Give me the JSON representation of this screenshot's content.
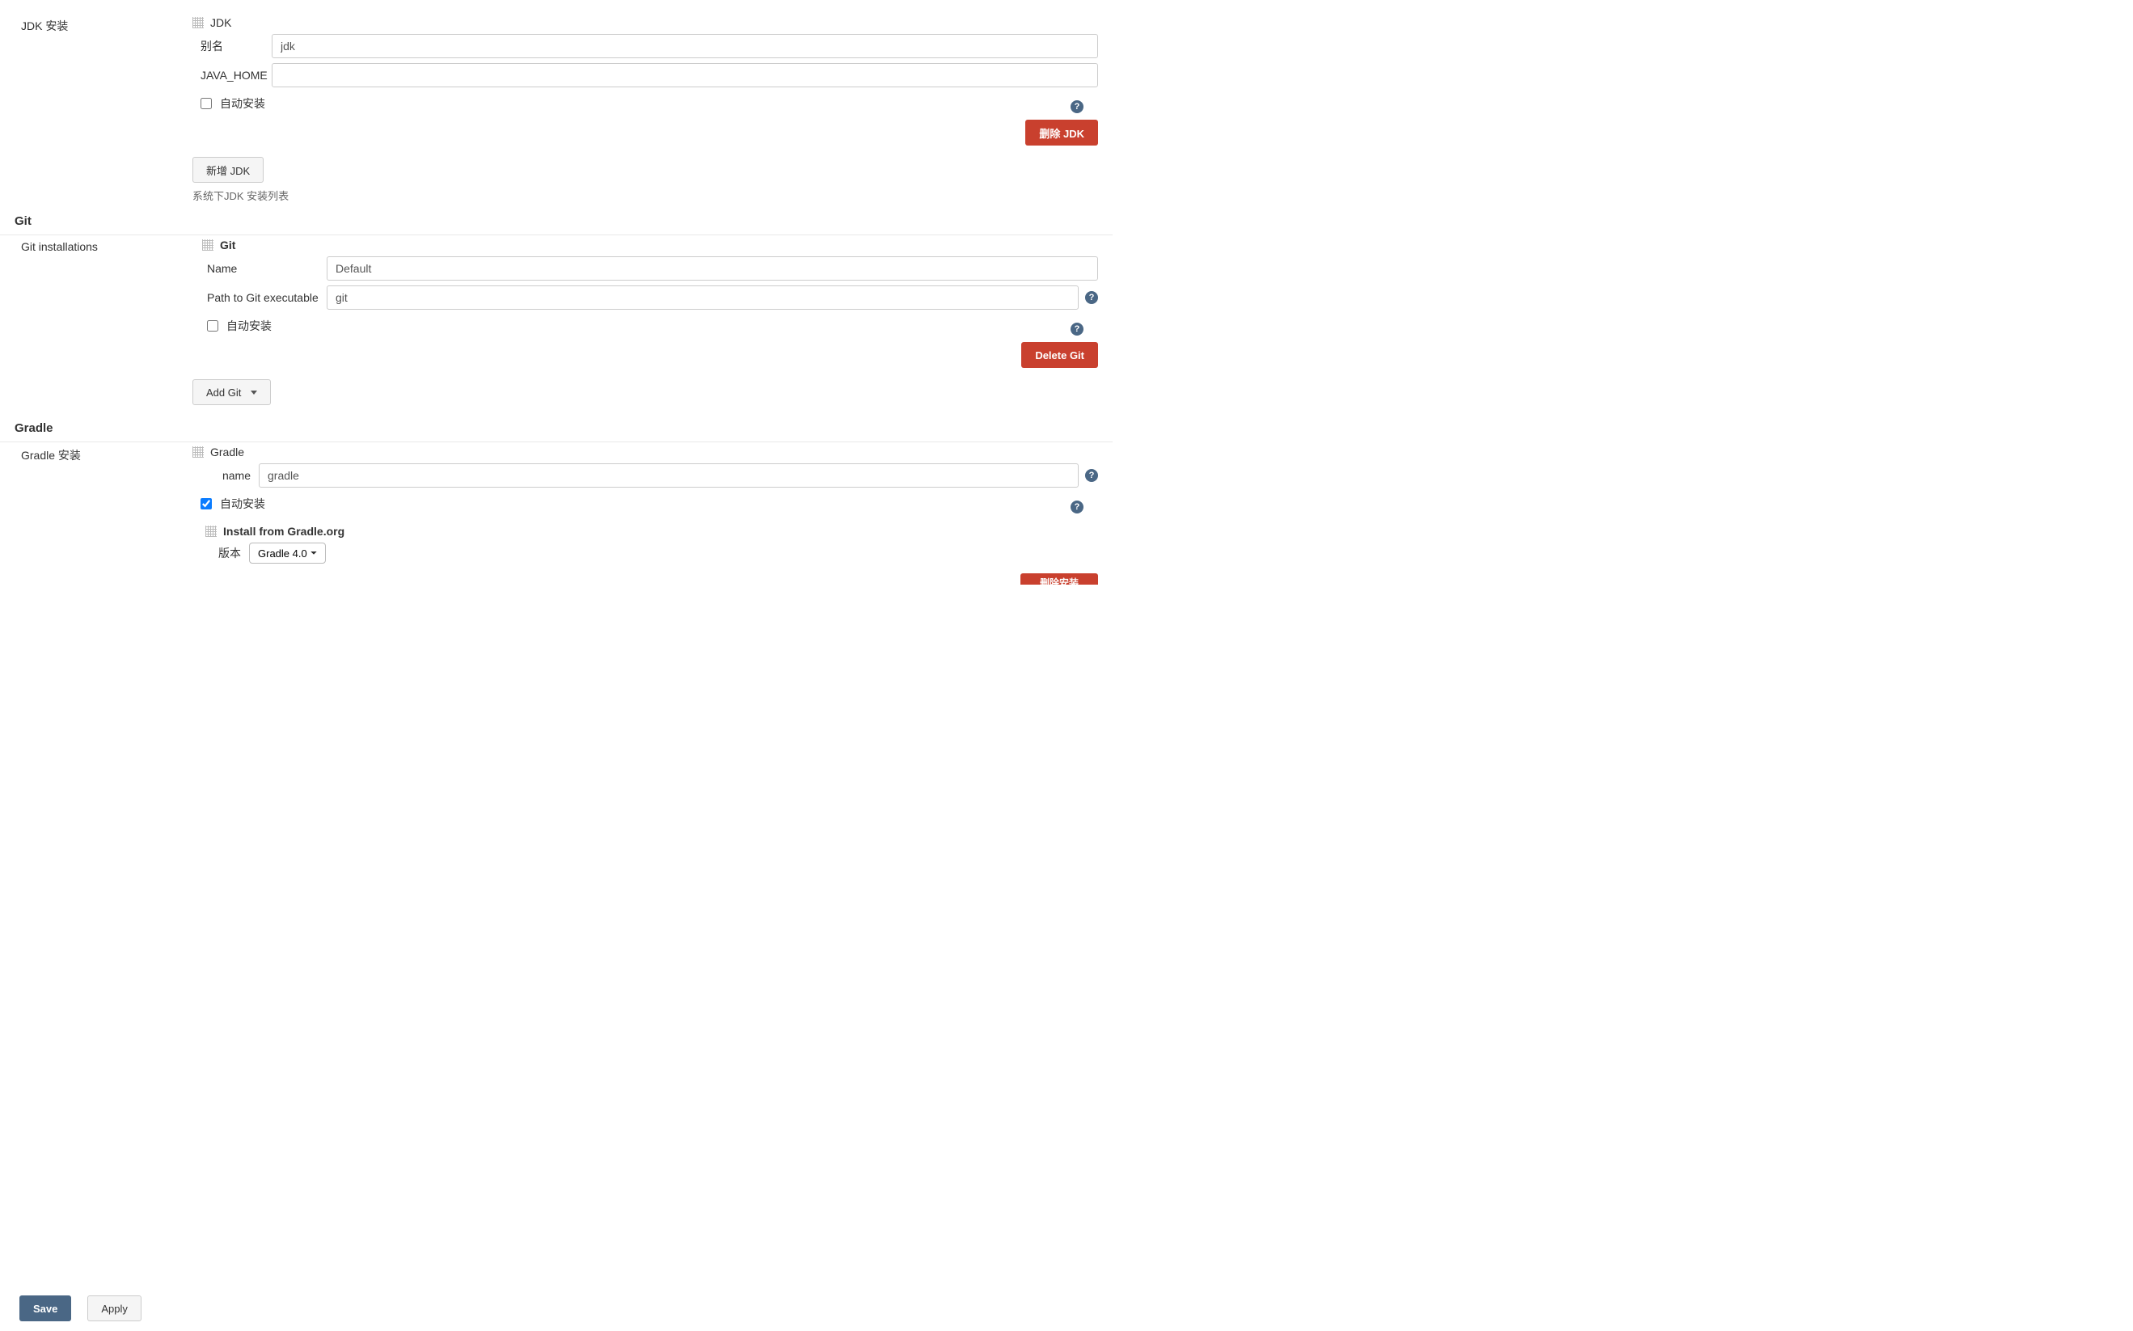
{
  "jdk": {
    "section_label": "JDK 安装",
    "tool_name": "JDK",
    "alias_label": "别名",
    "alias_value": "jdk",
    "java_home_label": "JAVA_HOME",
    "java_home_value": "",
    "auto_install_label": "自动安装",
    "auto_install_checked": false,
    "delete_btn": "删除 JDK",
    "add_btn": "新增 JDK",
    "helper_text": "系统下JDK 安装列表"
  },
  "git": {
    "section_title": "Git",
    "section_label": "Git installations",
    "tool_name": "Git",
    "name_label": "Name",
    "name_value": "Default",
    "path_label": "Path to Git executable",
    "path_value": "git",
    "auto_install_label": "自动安装",
    "auto_install_checked": false,
    "delete_btn": "Delete Git",
    "add_btn": "Add Git"
  },
  "gradle": {
    "section_title": "Gradle",
    "section_label": "Gradle 安装",
    "tool_name": "Gradle",
    "name_label": "name",
    "name_value": "gradle",
    "auto_install_label": "自动安装",
    "auto_install_checked": true,
    "installer_title": "Install from Gradle.org",
    "version_label": "版本",
    "version_value": "Gradle 4.0",
    "delete_installer_btn": "删除安装"
  },
  "footer": {
    "save": "Save",
    "apply": "Apply"
  },
  "help_glyph": "?"
}
